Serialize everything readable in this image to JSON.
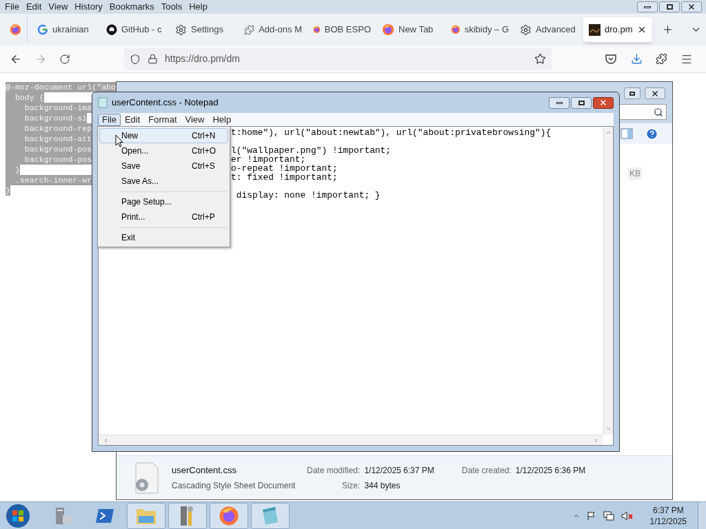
{
  "browser": {
    "menu": [
      "File",
      "Edit",
      "View",
      "History",
      "Bookmarks",
      "Tools",
      "Help"
    ],
    "tabs": [
      {
        "kind": "firefox",
        "selected": false
      },
      {
        "kind": "google",
        "label": "ukrainian",
        "selected": false
      },
      {
        "kind": "github",
        "label": "GitHub - c",
        "selected": false
      },
      {
        "kind": "gear",
        "label": "Settings",
        "selected": false
      },
      {
        "kind": "puzzle",
        "label": "Add-ons M",
        "selected": false
      },
      {
        "kind": "firefox",
        "label": "BOB ESPO",
        "selected": false
      },
      {
        "kind": "firefox",
        "label": "New Tab",
        "selected": false
      },
      {
        "kind": "firefox",
        "label": "skibidy – G",
        "selected": false
      },
      {
        "kind": "gear",
        "label": "Advanced",
        "selected": false
      },
      {
        "kind": "image",
        "label": "dro.pm",
        "selected": true
      }
    ],
    "url": "https://dro.pm/dm"
  },
  "page": {
    "code_lines": [
      "@-moz-document url(\"abo",
      "  body {",
      "    background-ima",
      "    background-si",
      "    background-rep",
      "    background-att",
      "    background-pos",
      "    background-pos",
      "  }",
      "  .search-inner-wr",
      "}"
    ]
  },
  "explorer": {
    "size_fragment": "KB",
    "details": {
      "file_name": "userContent.css",
      "file_type": "Cascading Style Sheet Document",
      "modified_label": "Date modified:",
      "modified_value": "1/12/2025 6:37 PM",
      "created_label": "Date created:",
      "created_value": "1/12/2025 6:36 PM",
      "size_label": "Size:",
      "size_value": "344 bytes"
    }
  },
  "notepad": {
    "title": "userContent.css - Notepad",
    "menu": [
      {
        "label": "File",
        "selected": true
      },
      {
        "label": "Edit",
        "selected": false
      },
      {
        "label": "Format",
        "selected": false
      },
      {
        "label": "View",
        "selected": false
      },
      {
        "label": "Help",
        "selected": false
      }
    ],
    "lines": [
      {
        "text": "t:home\"), url(\"about:newtab\"), url(\"about:privatebrowsing\"){",
        "blank_before": false
      },
      {
        "text": "l(\"wallpaper.png\") !important;",
        "blank_before": true
      },
      {
        "text": "er !important;",
        "blank_before": false
      },
      {
        "text": "o-repeat !important;",
        "blank_before": false
      },
      {
        "text": "t: fixed !important;",
        "blank_before": false
      },
      {
        "text": " display: none !important; }",
        "blank_before": true
      }
    ],
    "file_menu": [
      {
        "kind": "item",
        "label": "New",
        "shortcut": "Ctrl+N",
        "highlighted": true
      },
      {
        "kind": "item",
        "label": "Open...",
        "shortcut": "Ctrl+O",
        "highlighted": false
      },
      {
        "kind": "item",
        "label": "Save",
        "shortcut": "Ctrl+S",
        "highlighted": false
      },
      {
        "kind": "item",
        "label": "Save As...",
        "highlighted": false
      },
      {
        "kind": "separator"
      },
      {
        "kind": "item",
        "label": "Page Setup...",
        "highlighted": false
      },
      {
        "kind": "item",
        "label": "Print...",
        "shortcut": "Ctrl+P",
        "highlighted": false
      },
      {
        "kind": "separator"
      },
      {
        "kind": "item",
        "label": "Exit",
        "highlighted": false
      }
    ]
  },
  "taskbar": {
    "apps": [
      {
        "kind": "server",
        "open": false
      },
      {
        "kind": "powershell",
        "open": false
      },
      {
        "kind": "folder",
        "open": true
      },
      {
        "kind": "tools",
        "open": true
      },
      {
        "kind": "firefox",
        "open": true
      },
      {
        "kind": "notepad",
        "open": true
      }
    ],
    "time": "6:37 PM",
    "date": "1/12/2025"
  }
}
